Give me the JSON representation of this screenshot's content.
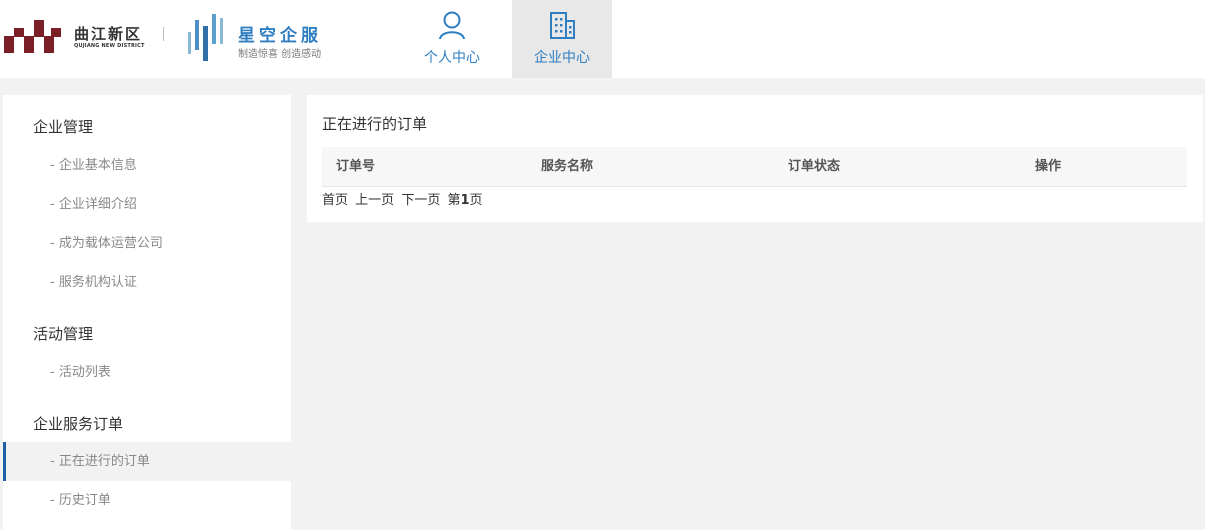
{
  "header": {
    "logo_qujiang": {
      "name_cn": "曲江新区",
      "name_en": "QUJIANG NEW DISTRICT",
      "color": "#7a1f25"
    },
    "logo_xingkong": {
      "name_cn": "星空企服",
      "slogan": "制造惊喜 创造感动",
      "color": "#2f7ec1"
    },
    "tabs": [
      {
        "label": "个人中心",
        "icon": "user-icon",
        "active": false
      },
      {
        "label": "企业中心",
        "icon": "building-icon",
        "active": true
      }
    ]
  },
  "sidebar": {
    "groups": [
      {
        "title": "企业管理",
        "items": [
          "- 企业基本信息",
          "- 企业详细介绍",
          "- 成为载体运营公司",
          "- 服务机构认证"
        ]
      },
      {
        "title": "活动管理",
        "items": [
          "- 活动列表"
        ]
      },
      {
        "title": "企业服务订单",
        "items": [
          "- 正在进行的订单",
          "- 历史订单"
        ]
      }
    ],
    "active_item": "- 正在进行的订单",
    "accent_color": "#1e5fa8"
  },
  "main": {
    "title": "正在进行的订单",
    "columns": [
      "订单号",
      "服务名称",
      "订单状态",
      "操作"
    ],
    "rows": [],
    "pager": {
      "first": "首页",
      "prev": "上一页",
      "next": "下一页",
      "page_prefix": "第",
      "page_number": "1",
      "page_suffix": "页"
    }
  }
}
